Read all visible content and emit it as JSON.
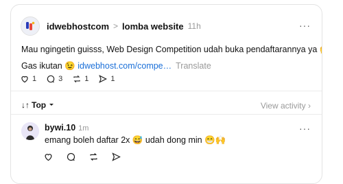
{
  "post": {
    "author": "idwebhostcom",
    "separator": ">",
    "community": "lomba website",
    "time": "11h",
    "more": "···",
    "text": "Mau ngingetin guisss, Web Design Competition udah buka pendaftarannya ya 🙌",
    "text2_prefix": "Gas ikutan 😉 ",
    "link": "idwebhost.com/compe…",
    "translate": "Translate",
    "likes": "1",
    "comments": "3",
    "reposts": "1",
    "shares": "1"
  },
  "sort": {
    "label": "Top"
  },
  "view_activity": "View activity",
  "reply": {
    "username": "bywi.10",
    "time": "1m",
    "more": "···",
    "text": "emang boleh daftar 2x 😅 udah dong min 😁🙌"
  },
  "colors": {
    "link": "#1a6fd8",
    "muted": "#999999"
  }
}
